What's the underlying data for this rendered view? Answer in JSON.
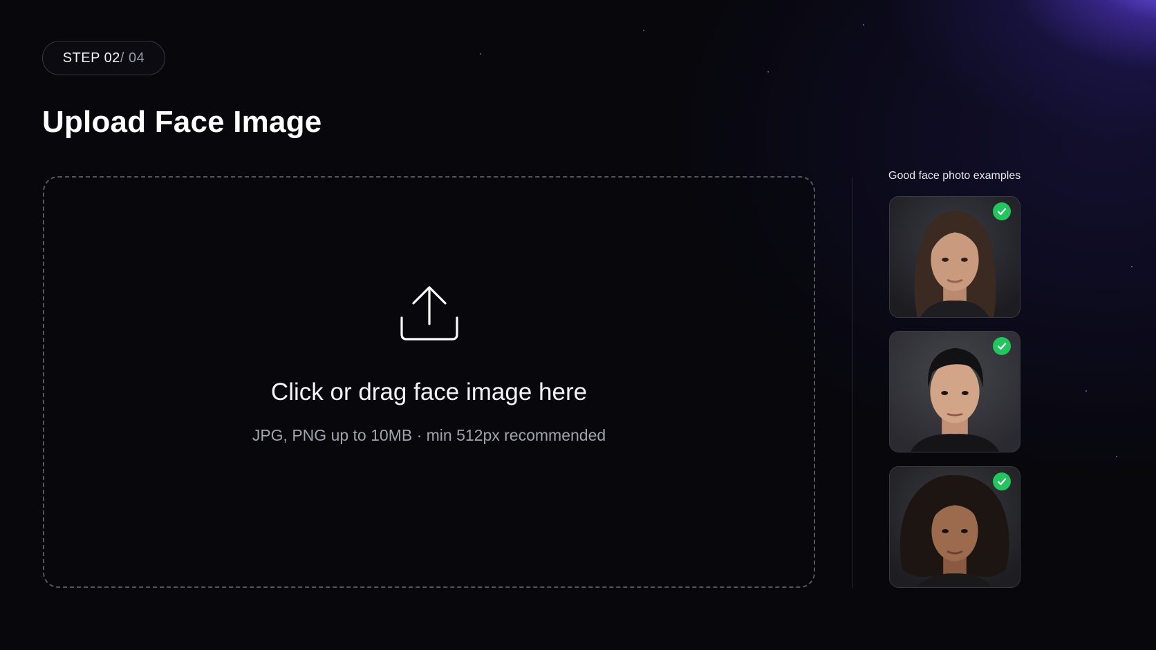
{
  "step": {
    "current": "STEP 02",
    "total": " / 04"
  },
  "title": "Upload Face Image",
  "dropzone": {
    "title": "Click or drag face image here",
    "hint": "JPG, PNG up to 10MB · min 512px recommended",
    "icon": "upload-icon"
  },
  "examples": {
    "label": "Good face photo examples",
    "items": [
      {
        "name": "example-photo-1",
        "hair": "long-dark-straight",
        "status_icon": "check-icon"
      },
      {
        "name": "example-photo-2",
        "hair": "short-black",
        "status_icon": "check-icon"
      },
      {
        "name": "example-photo-3",
        "hair": "curly-dark",
        "status_icon": "check-icon"
      }
    ]
  },
  "colors": {
    "background": "#07070c",
    "accent_glow": "#7c5cff",
    "check": "#22c55e",
    "border": "#55555e"
  }
}
